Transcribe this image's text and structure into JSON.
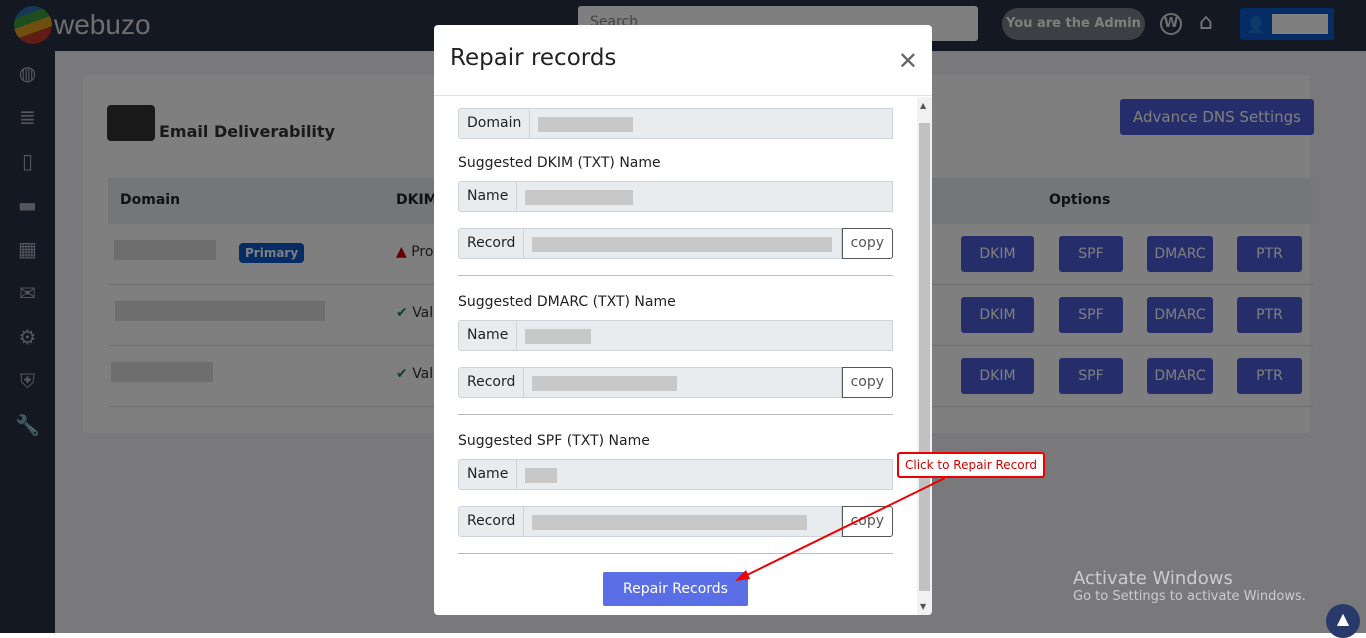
{
  "brand": "webuzo",
  "topbar": {
    "search_placeholder": "Search",
    "admin_label": "You are the Admin"
  },
  "sidebar": [
    "globe-icon",
    "database-icon",
    "file-icon",
    "folder-icon",
    "apps-icon",
    "mail-icon",
    "cogs-icon",
    "shield-icon",
    "wrench-icon"
  ],
  "page": {
    "title": "Email Deliverability",
    "advance_btn": "Advance DNS Settings",
    "columns": {
      "domain": "Domain",
      "dkim": "DKIM",
      "options": "Options"
    },
    "rows": [
      {
        "badge": "Primary",
        "status": "Pro",
        "status_type": "warning"
      },
      {
        "status": "Val",
        "status_type": "valid"
      },
      {
        "status": "Val",
        "status_type": "valid"
      }
    ],
    "option_buttons": [
      "DKIM",
      "SPF",
      "DMARC",
      "PTR"
    ]
  },
  "modal": {
    "title": "Repair records",
    "domain_label": "Domain",
    "sections": [
      {
        "heading": "Suggested DKIM (TXT) Name"
      },
      {
        "heading": "Suggested DMARC (TXT) Name"
      },
      {
        "heading": "Suggested SPF (TXT) Name"
      }
    ],
    "name_label": "Name",
    "record_label": "Record",
    "copy_label": "copy",
    "repair_btn": "Repair Records"
  },
  "annotation": "Click to Repair Record",
  "watermark": {
    "line1": "Activate Windows",
    "line2": "Go to Settings to activate Windows."
  },
  "colors": {
    "primary": "#4a5cd6",
    "annotation": "#e00000"
  }
}
